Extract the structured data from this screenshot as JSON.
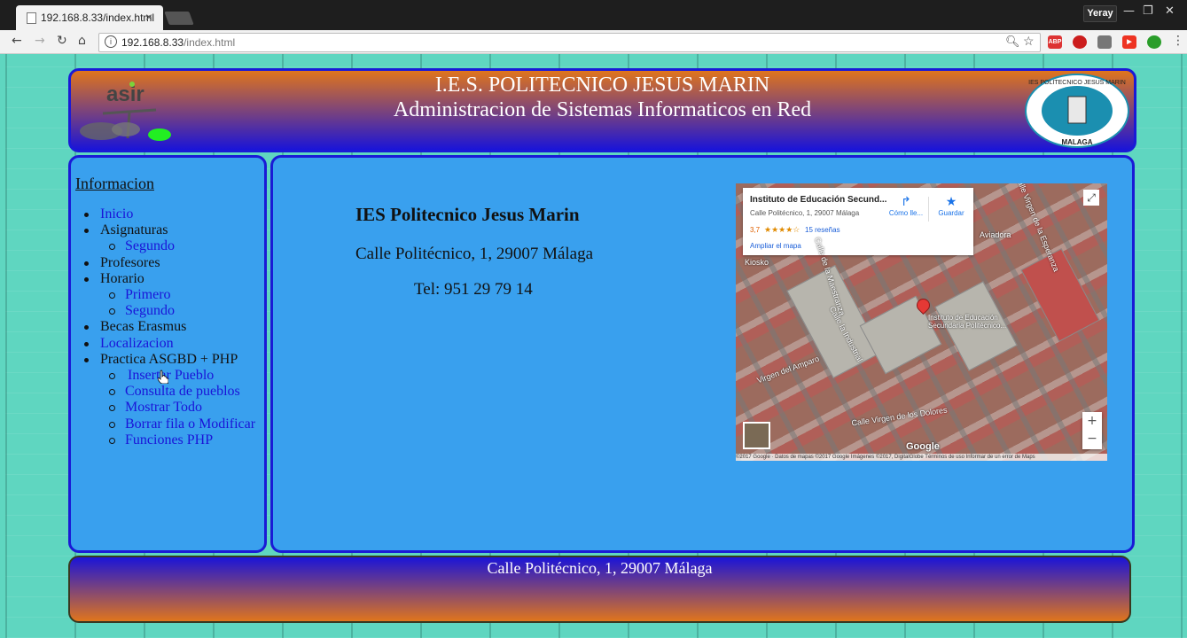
{
  "browser": {
    "tab_title": "192.168.8.33/index.html",
    "tab_close": "×",
    "url_host": "192.168.8.33",
    "url_path": "/index.html",
    "profile_name": "Yeray",
    "icons": [
      "back-icon",
      "forward-icon",
      "reload-icon",
      "home-icon",
      "info-icon",
      "zoom-icon",
      "bookmark-star-icon"
    ],
    "extensions": [
      {
        "name": "abp-extension-icon",
        "label": "ABP",
        "color": "#d33"
      },
      {
        "name": "opera-extension-icon",
        "label": "",
        "color": "#cc1d1d"
      },
      {
        "name": "gray-extension-icon",
        "label": "",
        "color": "#777"
      },
      {
        "name": "red-play-extension-icon",
        "label": "",
        "color": "#e32"
      },
      {
        "name": "green-ring-extension-icon",
        "label": "",
        "color": "#2a9d2a"
      }
    ]
  },
  "header": {
    "title_line1": "I.E.S. POLITECNICO JESUS MARIN",
    "title_line2": "Administracion de Sistemas Informaticos en Red",
    "logo_left_text": "asir",
    "logo_right_text_top": "IES POLITECNICO JESUS MARIN",
    "logo_right_text_bottom": "MALAGA"
  },
  "sidebar": {
    "heading": "Informacion",
    "items": [
      {
        "label": "Inicio",
        "type": "link",
        "level": 1
      },
      {
        "label": "Asignaturas",
        "type": "plain",
        "level": 1
      },
      {
        "label": "Segundo",
        "type": "link",
        "level": 2
      },
      {
        "label": "Profesores",
        "type": "plain",
        "level": 1
      },
      {
        "label": "Horario",
        "type": "plain",
        "level": 1
      },
      {
        "label": "Primero",
        "type": "link",
        "level": 2
      },
      {
        "label": "Segundo",
        "type": "link",
        "level": 2
      },
      {
        "label": "Becas Erasmus",
        "type": "plain",
        "level": 1
      },
      {
        "label": "Localizacion",
        "type": "link",
        "level": 1
      },
      {
        "label": "Practica ASGBD + PHP",
        "type": "plain",
        "level": 1
      },
      {
        "label": "Insertar Pueblo",
        "type": "link",
        "level": 2
      },
      {
        "label": "Consulta de pueblos",
        "type": "link",
        "level": 2
      },
      {
        "label": "Mostrar Todo",
        "type": "link",
        "level": 2
      },
      {
        "label": "Borrar fila o Modificar",
        "type": "link",
        "level": 2
      },
      {
        "label": "Funciones PHP",
        "type": "link",
        "level": 2
      }
    ]
  },
  "main": {
    "name": "IES Politecnico Jesus Marin",
    "address": "Calle Politécnico, 1, 29007 Málaga",
    "phone": "Tel: 951 29 79 14"
  },
  "map": {
    "place_name": "Instituto de Educación Secund...",
    "place_address": "Calle Politécnico, 1, 29007 Málaga",
    "rating": "3,7",
    "stars": "★★★★☆",
    "reviews": "15 reseñas",
    "enlarge": "Ampliar el mapa",
    "directions": "Cómo lle...",
    "save": "Guardar",
    "pin_label": "Instituto de Educación Secundaria Politécnico...",
    "streets": [
      "Calle de la Maestranza",
      "Calle Virgen de la Esperanza",
      "Calle Virgen de los Dolores",
      "Virgen del Amparo",
      "Calle la Industrial",
      "Kiosko",
      "Aviadora"
    ],
    "zoom_in": "+",
    "zoom_out": "−",
    "google_logo": "Google",
    "attribution": "©2017 Google · Datos de mapas ©2017 Google Imágenes ©2017, DigitalGlobe   Términos de uso   Informar de un error de Maps"
  },
  "footer": {
    "text": "Calle Politécnico, 1, 29007 Málaga"
  },
  "colors": {
    "accent_blue": "#1a14d8",
    "panel_blue": "#39a0ee",
    "orange": "#e0751c",
    "background_teal": "#5fd6c0"
  }
}
